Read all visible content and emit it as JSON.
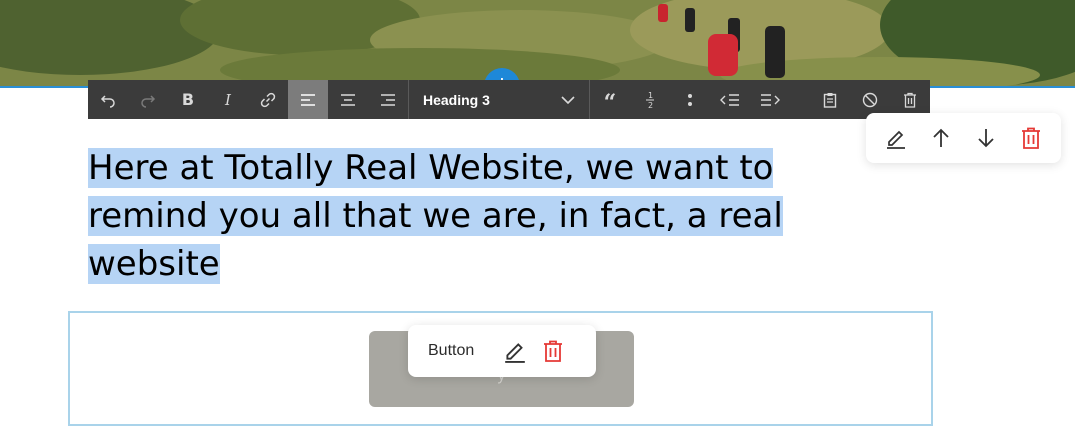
{
  "toolbar": {
    "heading_select": "Heading 3"
  },
  "content": {
    "heading_lines": [
      "Here at Totally Real Website, we want to",
      "remind you all that we are, in fact, a real",
      "website"
    ]
  },
  "button_block": {
    "popup_label": "Button",
    "button_label": "y"
  },
  "colors": {
    "accent": "#1e88d8",
    "danger": "#e53935",
    "selection": "#b6d4f5",
    "toolbar_bg": "#3b3b3b"
  }
}
